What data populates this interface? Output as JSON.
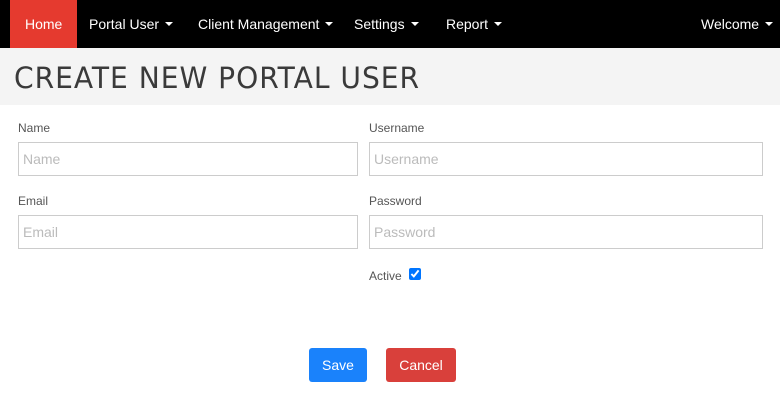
{
  "nav": {
    "items": [
      {
        "label": "Home",
        "active": true
      },
      {
        "label": "Portal User",
        "dropdown": true
      },
      {
        "label": "Client Management",
        "dropdown": true
      },
      {
        "label": "Settings",
        "dropdown": true
      },
      {
        "label": "Report",
        "dropdown": true
      }
    ],
    "welcome": "Welcome",
    "colors": {
      "bar": "#000000",
      "active": "#e53a2f"
    }
  },
  "page": {
    "title": "CREATE NEW PORTAL USER"
  },
  "form": {
    "name": {
      "label": "Name",
      "placeholder": "Name",
      "value": ""
    },
    "username": {
      "label": "Username",
      "placeholder": "Username",
      "value": ""
    },
    "email": {
      "label": "Email",
      "placeholder": "Email",
      "value": ""
    },
    "password": {
      "label": "Password",
      "placeholder": "Password",
      "value": ""
    },
    "active": {
      "label": "Active",
      "checked": true
    }
  },
  "buttons": {
    "save": "Save",
    "cancel": "Cancel",
    "colors": {
      "save": "#1a82fb",
      "cancel": "#d9403b"
    }
  }
}
